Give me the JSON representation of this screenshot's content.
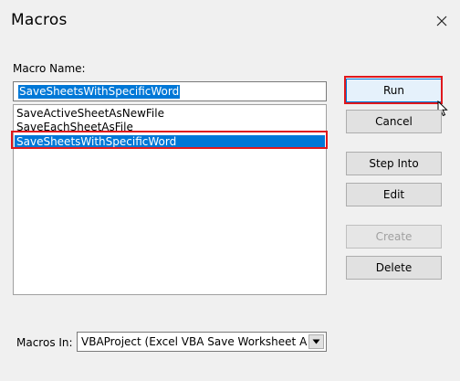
{
  "window": {
    "title": "Macros",
    "close_icon": "close-icon"
  },
  "macro_name": {
    "label": "Macro Name:",
    "value": "SaveSheetsWithSpecificWord"
  },
  "macro_list": {
    "items": [
      "SaveActiveSheetAsNewFile",
      "SaveEachSheetAsFile",
      "SaveSheetsWithSpecificWord"
    ],
    "selected_index": 2
  },
  "buttons": {
    "run": "Run",
    "cancel": "Cancel",
    "step_into": "Step Into",
    "edit": "Edit",
    "create": "Create",
    "delete": "Delete"
  },
  "macros_in": {
    "label": "Macros In:",
    "value": "VBAProject (Excel VBA Save Worksheet As"
  },
  "colors": {
    "selection": "#0078d7",
    "highlight_box": "#e0181c",
    "dialog_bg": "#f0f0f0"
  }
}
